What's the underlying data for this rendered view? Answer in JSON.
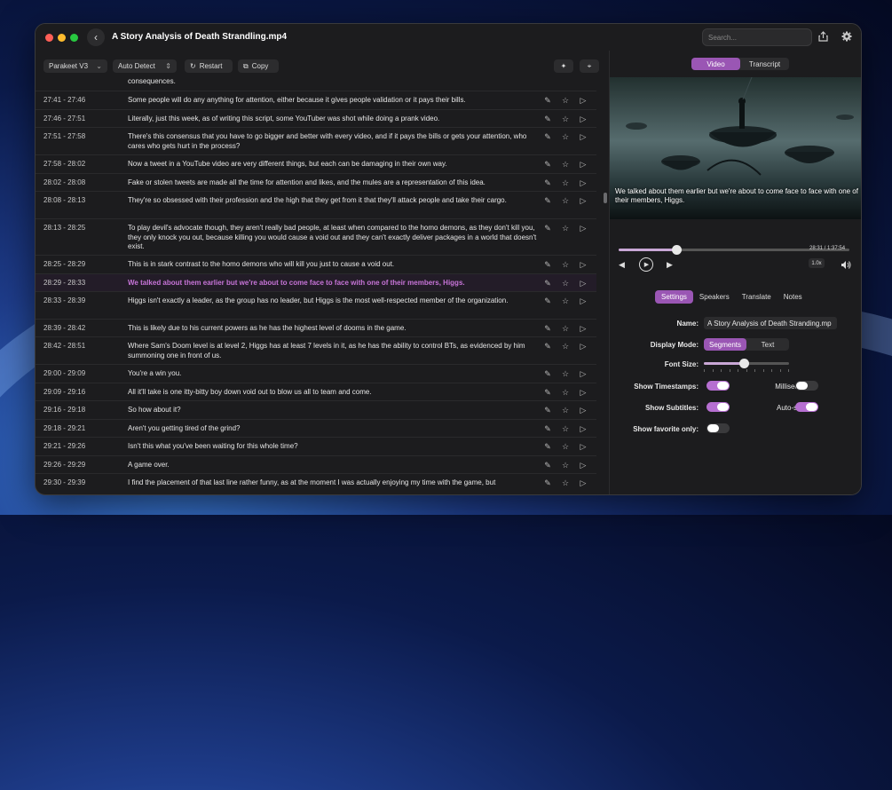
{
  "window": {
    "title": "A Story Analysis of Death Strandling.mp4",
    "search_placeholder": "Search...",
    "back_glyph": "‹"
  },
  "toolbar": {
    "model": "Parakeet V3",
    "language": "Auto Detect",
    "restart_label": "Restart",
    "copy_label": "Copy"
  },
  "segments": [
    {
      "ts": "",
      "text": "consequences.",
      "h": 18
    },
    {
      "ts": "27:41 - 27:46",
      "text": "Some people will do any anything for attention, either because it gives people validation or it pays their bills.",
      "h": 21
    },
    {
      "ts": "27:46 - 27:51",
      "text": "Literally, just this week, as of writing this script, some YouTuber was shot while doing a prank video.",
      "h": 20
    },
    {
      "ts": "27:51 - 27:58",
      "text": "There's this consensus that you have to go bigger and better with every video, and if it pays the bills or gets your attention, who cares who gets hurt in the process?",
      "h": 31
    },
    {
      "ts": "27:58 - 28:02",
      "text": "Now a tweet in a YouTube video are very different things, but each can be damaging in their own way.",
      "h": 21
    },
    {
      "ts": "28:02 - 28:08",
      "text": "Fake or stolen tweets are made all the time for attention and likes, and the mules are a representation of this idea.",
      "h": 20
    },
    {
      "ts": "28:08 - 28:13",
      "text": "They're so obsessed with their profession and the high that they get from it that they'll attack people and take their cargo.",
      "h": 31
    },
    {
      "ts": "28:13 - 28:25",
      "text": "To play devil's advocate though, they aren't really bad people, at least when compared to the homo demons, as they don't kill you, they only knock you out, because killing you would cause a void out and they can't exactly deliver packages in a world that doesn't exist.",
      "h": 41
    },
    {
      "ts": "28:25 - 28:29",
      "text": "This is in stark contrast to the homo demons who will kill you just to cause a void out.",
      "h": 21
    },
    {
      "ts": "28:29 - 28:33",
      "text": "We talked about them earlier but we're about to come face to face with one of their members, Higgs.",
      "h": 20
    },
    {
      "ts": "28:33 - 28:39",
      "text": "Higgs isn't exactly a leader, as the group has no leader, but Higgs is the most well-respected member of the organization.",
      "h": 31
    },
    {
      "ts": "28:39 - 28:42",
      "text": "This is likely due to his current powers as he has the highest level of dooms in the game.",
      "h": 20
    },
    {
      "ts": "28:42 - 28:51",
      "text": "Where Sam's Doom level is at level 2, Higgs has at least 7 levels in it, as he has the ability to control BTs, as evidenced by him summoning one in front of us.",
      "h": 31
    },
    {
      "ts": "29:00 - 29:09",
      "text": "You're a win you.",
      "h": 21
    },
    {
      "ts": "29:09 - 29:16",
      "text": "All it'll take is one itty-bitty boy down void out to blow us all to team and come.",
      "h": 20
    },
    {
      "ts": "29:16 - 29:18",
      "text": "So how about it?",
      "h": 21
    },
    {
      "ts": "29:18 - 29:21",
      "text": "Aren't you getting tired of the grind?",
      "h": 20
    },
    {
      "ts": "29:21 - 29:26",
      "text": "Isn't this what you've been waiting for this whole time?",
      "h": 21
    },
    {
      "ts": "29:26 - 29:29",
      "text": "A game over.",
      "h": 20
    },
    {
      "ts": "29:30 - 29:39",
      "text": "I find the placement of that last line rather funny, as at the moment I was actually enjoying my time with the game, but",
      "h": 30
    }
  ],
  "highlighted_index": 9,
  "right_panel": {
    "tabs": [
      "Video",
      "Transcript"
    ],
    "active_tab": "Video",
    "subtitle": "We talked about them earlier but we're about to come face to face with one of their members, Higgs.",
    "time": "28:31 / 1:37:54",
    "progress": 0.25,
    "rate": "1.0x",
    "settings_tabs": [
      "Settings",
      "Speakers",
      "Translate",
      "Notes"
    ],
    "active_settings_tab": "Settings",
    "name_label": "Name:",
    "name_value": "A Story Analysis of Death Stranding.mp",
    "display_mode_label": "Display Mode:",
    "display_modes": [
      "Segments",
      "Text"
    ],
    "active_display_mode": "Segments",
    "font_size_label": "Font Size:",
    "font_size_level": 0.47,
    "show_timestamps_label": "Show Timestamps:",
    "show_timestamps": true,
    "millisecond_label": "Millisecond:",
    "millisecond": false,
    "show_subtitles_label": "Show Subtitles:",
    "show_subtitles": true,
    "autoscroll_label": "Auto-scroll:",
    "autoscroll": true,
    "show_favorite_label": "Show favorite only:",
    "show_favorite": false
  },
  "colors": {
    "accent": "#9a56b4",
    "highlight_text": "#c774d8",
    "traffic_red": "#ff5f57",
    "traffic_yellow": "#febc2e",
    "traffic_green": "#28c840"
  }
}
